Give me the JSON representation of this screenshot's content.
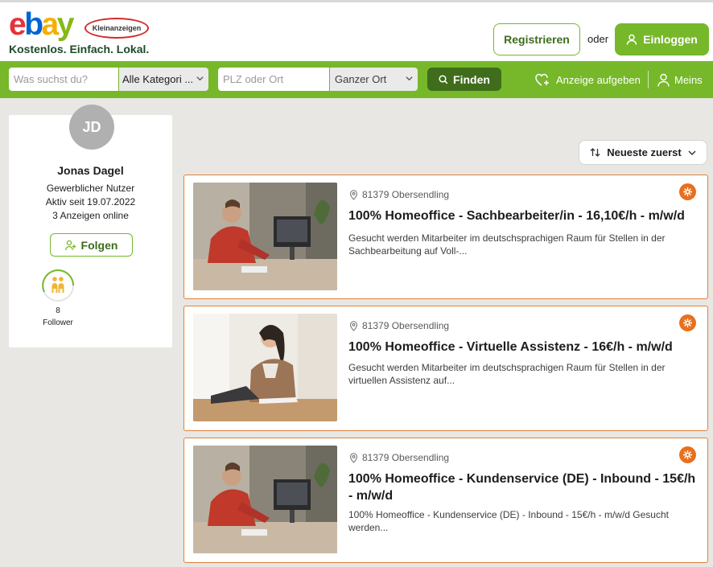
{
  "header": {
    "logo_text": "ebay",
    "logo_badge": "Kleinanzeigen",
    "tagline": "Kostenlos. Einfach. Lokal.",
    "register_label": "Registrieren",
    "or_label": "oder",
    "login_label": "Einloggen",
    "accent": "#76b82a"
  },
  "search": {
    "what_placeholder": "Was suchst du?",
    "category_value": "Alle Kategori ...",
    "plz_placeholder": "PLZ oder Ort",
    "radius_value": "Ganzer Ort",
    "find_label": "Finden",
    "post_ad_label": "Anzeige aufgeben",
    "mine_label": "Meins"
  },
  "profile": {
    "initials": "JD",
    "name": "Jonas Dagel",
    "type": "Gewerblicher Nutzer",
    "active_since": "Aktiv seit 19.07.2022",
    "ads_online": "3 Anzeigen online",
    "follow_label": "Folgen",
    "follower_count": "8",
    "follower_label": "Follower"
  },
  "sort": {
    "label": "Neueste zuerst"
  },
  "listings": [
    {
      "location": "81379 Obersendling",
      "title": "100% Homeoffice - Sachbearbeiter/in - 16,10€/h - m/w/d",
      "description": "Gesucht werden Mitarbeiter im deutschsprachigen Raum für Stellen in der Sachbearbeitung auf Voll-...",
      "image": "man-at-desktop-computer"
    },
    {
      "location": "81379 Obersendling",
      "title": "100% Homeoffice - Virtuelle Assistenz - 16€/h - m/w/d",
      "description": "Gesucht werden Mitarbeiter im deutschsprachigen Raum für Stellen in der virtuellen Assistenz auf...",
      "image": "woman-at-laptop"
    },
    {
      "location": "81379 Obersendling",
      "title": "100% Homeoffice - Kundenservice (DE) - Inbound - 15€/h - m/w/d",
      "description": "100% Homeoffice - Kundenservice (DE) - Inbound - 15€/h - m/w/d Gesucht werden...",
      "image": "man-at-desktop-computer"
    }
  ]
}
